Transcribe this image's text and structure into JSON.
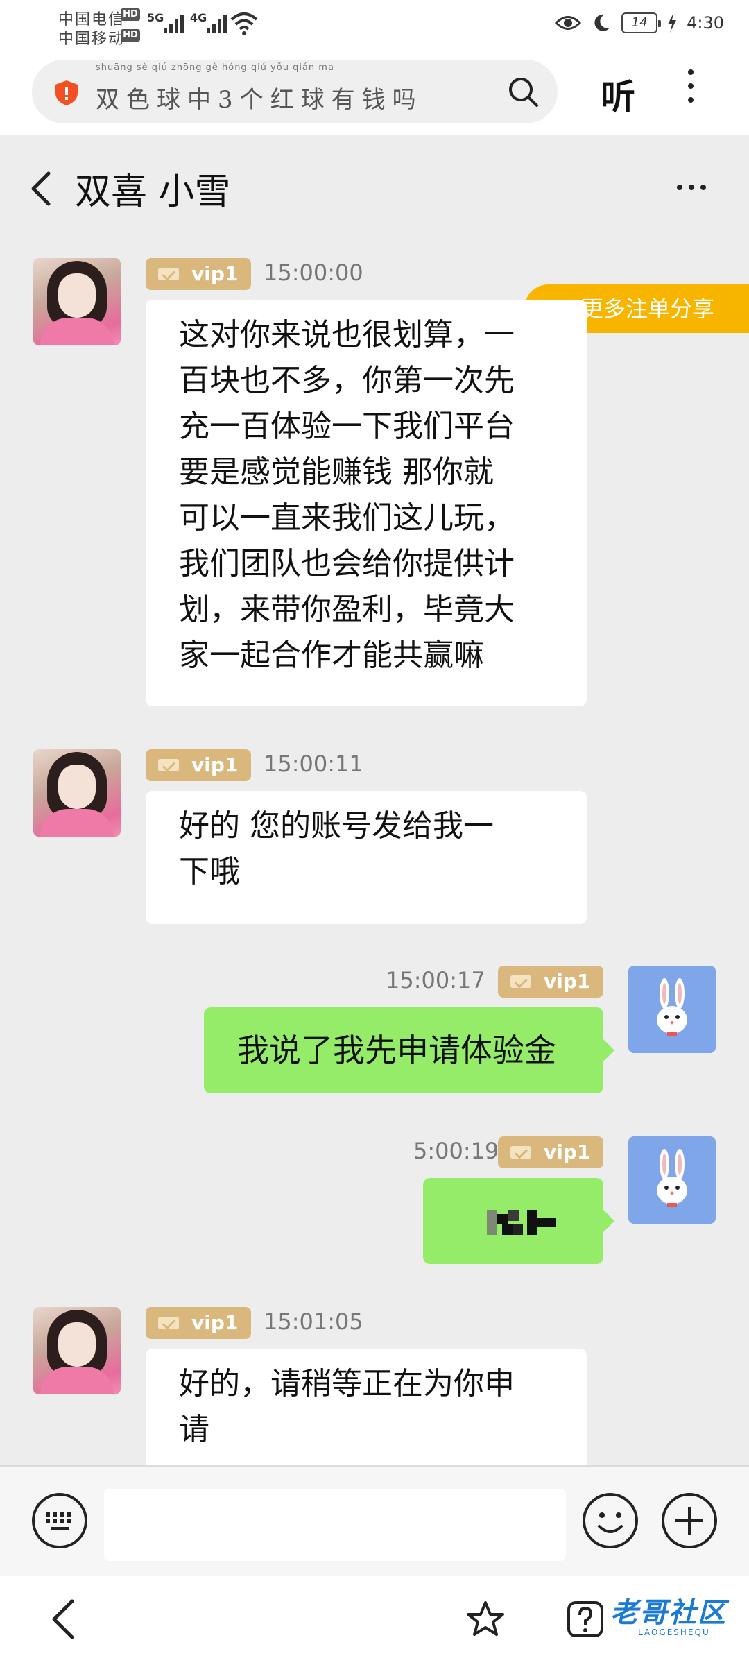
{
  "status_bar": {
    "carrier_1": "中国电信",
    "carrier_2": "中国移动",
    "hd_1": "HD",
    "hd_2": "HD",
    "network_1": "5G",
    "network_2": "4G",
    "battery": "14",
    "time": "4:30"
  },
  "search": {
    "pinyin": "shuāng sè qiú zhōng gè hóng qiú yǒu qián ma",
    "query": "双色球中3个红球有钱吗",
    "listen_label": "听"
  },
  "chat": {
    "back_icon": "chevron-left-icon",
    "title": "双喜 小雪",
    "share_label": "更多注单分享"
  },
  "messages": [
    {
      "side": "left",
      "vip": "vip1",
      "time": "15:00:00",
      "lines": [
        "这对你来说也很划算，一",
        "百块也不多，你第一次先",
        "充一百体验一下我们平台",
        "要是感觉能赚钱 那你就",
        "可以一直来我们这儿玩，",
        "我们团队也会给你提供计",
        "划，来带你盈利，毕竟大",
        "家一起合作才能共赢嘛"
      ]
    },
    {
      "side": "left",
      "vip": "vip1",
      "time": "15:00:11",
      "lines": [
        "好的 您的账号发给我一",
        "下哦"
      ]
    },
    {
      "side": "right",
      "vip": "vip1",
      "time": "15:00:17",
      "lines": [
        "我说了我先申请体验金"
      ]
    },
    {
      "side": "right",
      "vip": "vip1",
      "time": "5:00:19",
      "lines": []
    },
    {
      "side": "left",
      "vip": "vip1",
      "time": "15:01:05",
      "lines": [
        "好的，请稍等正在为你申",
        "请"
      ]
    }
  ],
  "input": {
    "placeholder": ""
  },
  "nav": {
    "watermark": "老哥社区",
    "watermark_sub": "LAOGESHEQU"
  },
  "colors": {
    "accent_orange": "#f7b500",
    "vip_gold": "#d9b77d",
    "bubble_green": "#95ec69",
    "bunny_avatar_bg": "#7fa6e8"
  }
}
